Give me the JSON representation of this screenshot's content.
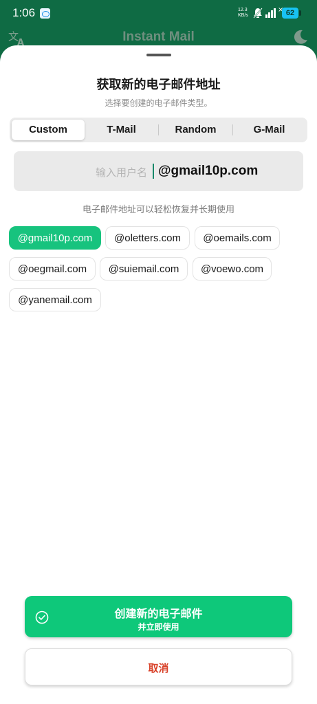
{
  "status_bar": {
    "time": "1:06",
    "net_speed_value": "12.3",
    "net_speed_unit": "KB/s",
    "battery": "62",
    "battery_color": "#18c2f2"
  },
  "app_bar": {
    "title": "Instant Mail",
    "left_icon": "translate-icon",
    "right_icon": "moon-icon"
  },
  "sheet": {
    "title": "获取新的电子邮件地址",
    "subtitle": "选择要创建的电子邮件类型。",
    "tabs": [
      {
        "label": "Custom",
        "active": true
      },
      {
        "label": "T-Mail",
        "active": false
      },
      {
        "label": "Random",
        "active": false
      },
      {
        "label": "G-Mail",
        "active": false
      }
    ],
    "username_input": {
      "placeholder": "输入用户名",
      "value": "",
      "domain_suffix": "@gmail10p.com"
    },
    "hint": "电子邮件地址可以轻松恢复并长期使用",
    "domains": [
      {
        "label": "@gmail10p.com",
        "selected": true
      },
      {
        "label": "@oletters.com",
        "selected": false
      },
      {
        "label": "@oemails.com",
        "selected": false
      },
      {
        "label": "@oegmail.com",
        "selected": false
      },
      {
        "label": "@suiemail.com",
        "selected": false
      },
      {
        "label": "@voewo.com",
        "selected": false
      },
      {
        "label": "@yanemail.com",
        "selected": false
      }
    ],
    "create_button": {
      "label": "创建新的电子邮件",
      "sublabel": "并立即使用",
      "icon": "check-circle-icon",
      "color": "#0ec87a"
    },
    "cancel_button": {
      "label": "取消",
      "color": "#d9432b"
    }
  },
  "colors": {
    "header": "#0f6b44",
    "accent": "#17c37e"
  }
}
